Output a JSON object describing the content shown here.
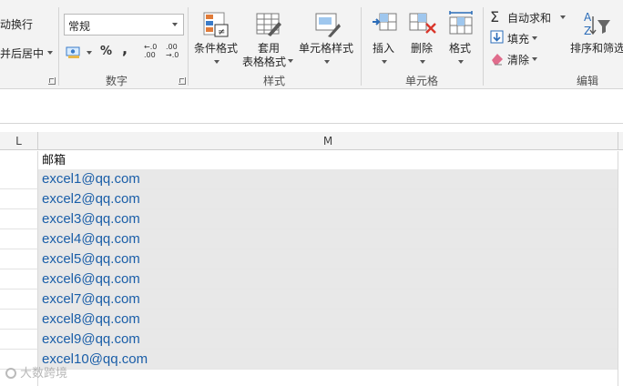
{
  "ribbon": {
    "alignment": {
      "wrap_text": "动换行",
      "merge_center": "并后居中"
    },
    "number": {
      "format_value": "常规",
      "percent": "%",
      "comma": ",",
      "decimal_increase": "←.0 .00",
      "decimal_decrease": ".00 →.0",
      "group_label": "数字"
    },
    "styles": {
      "conditional_format": "条件格式",
      "table_format_line1": "套用",
      "table_format_line2": "表格格式",
      "cell_styles": "单元格样式",
      "group_label": "样式"
    },
    "cells": {
      "insert": "插入",
      "delete": "删除",
      "format": "格式",
      "group_label": "单元格"
    },
    "editing": {
      "autosum": "自动求和",
      "fill": "填充",
      "clear": "清除",
      "sort_filter": "排序和筛选",
      "group_label": "编辑"
    }
  },
  "grid": {
    "columns": [
      "L",
      "M"
    ],
    "header_cell": "邮箱",
    "emails": [
      "excel1@qq.com",
      "excel2@qq.com",
      "excel3@qq.com",
      "excel4@qq.com",
      "excel5@qq.com",
      "excel6@qq.com",
      "excel7@qq.com",
      "excel8@qq.com",
      "excel9@qq.com",
      "excel10@qq.com"
    ]
  },
  "watermark": "大数跨境",
  "colors": {
    "link": "#1a5ea8",
    "selection": "#e8e8e8",
    "ribbon_bg": "#f3f3f3"
  }
}
